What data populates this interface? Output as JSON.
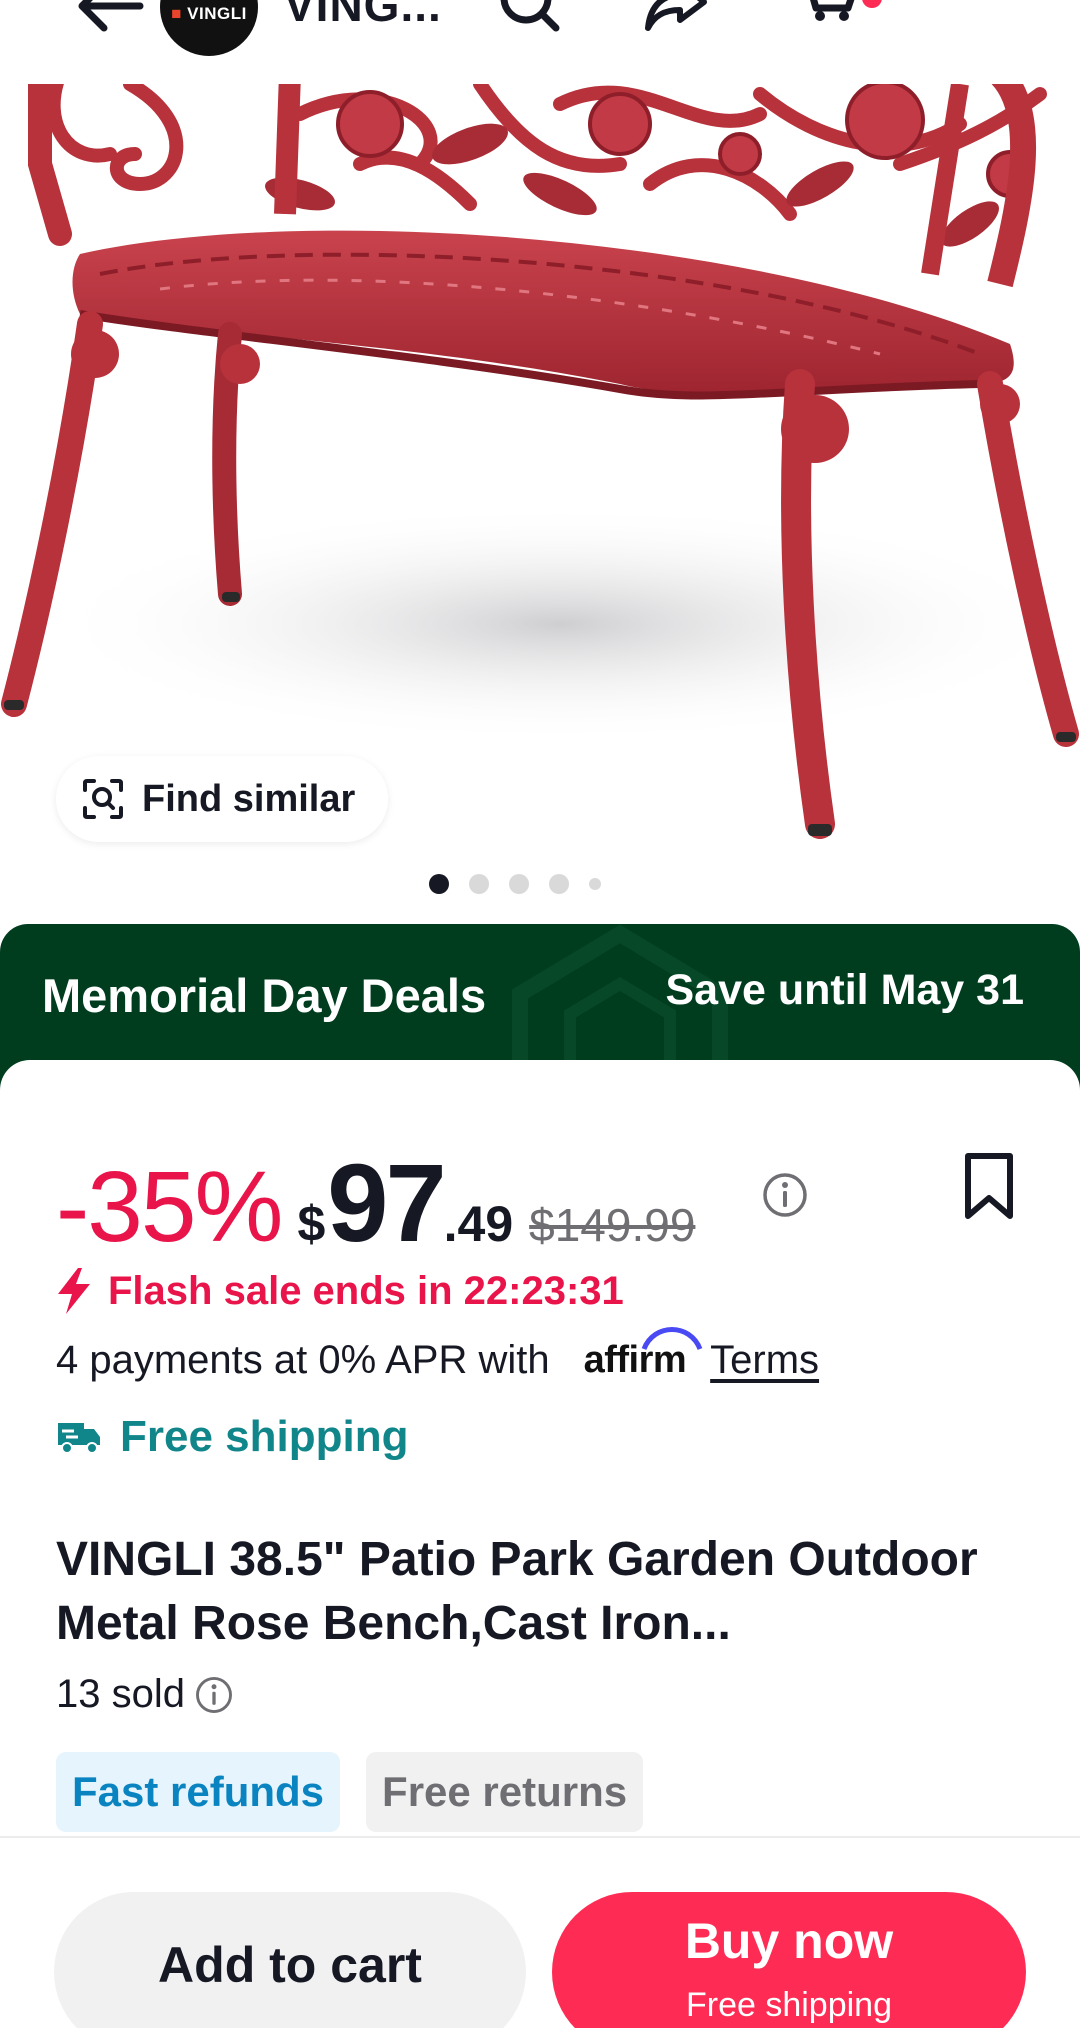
{
  "header": {
    "store_logo_text": "VINGLI",
    "store_name": "VING..."
  },
  "hero": {
    "find_similar_label": "Find similar",
    "carousel": {
      "total": 5,
      "active": 1
    }
  },
  "promo": {
    "title": "Memorial Day Deals",
    "until": "Save until May 31"
  },
  "product": {
    "discount": "-35%",
    "currency": "$",
    "price_int": "97",
    "price_dec": ".49",
    "original_price": "$149.99",
    "flash_sale": "Flash sale ends in 22:23:31",
    "payments_text": "4 payments at 0% APR with",
    "affirm_logo": "affirm",
    "terms_label": "Terms",
    "shipping": "Free shipping",
    "title": "VINGLI 38.5\" Patio Park Garden Outdoor Metal Rose Bench,Cast Iron...",
    "sold": "13 sold",
    "tags": [
      "Fast refunds",
      "Free returns"
    ]
  },
  "actions": {
    "add_to_cart": "Add to cart",
    "buy_now": "Buy now",
    "buy_now_sub": "Free shipping"
  },
  "colors": {
    "accent": "#fe2c55",
    "sale": "#e8144a",
    "promo_bg": "#003d1f",
    "shipping": "#11868a",
    "refund_tag": "#0a84c1",
    "bench": "#b8323c"
  }
}
